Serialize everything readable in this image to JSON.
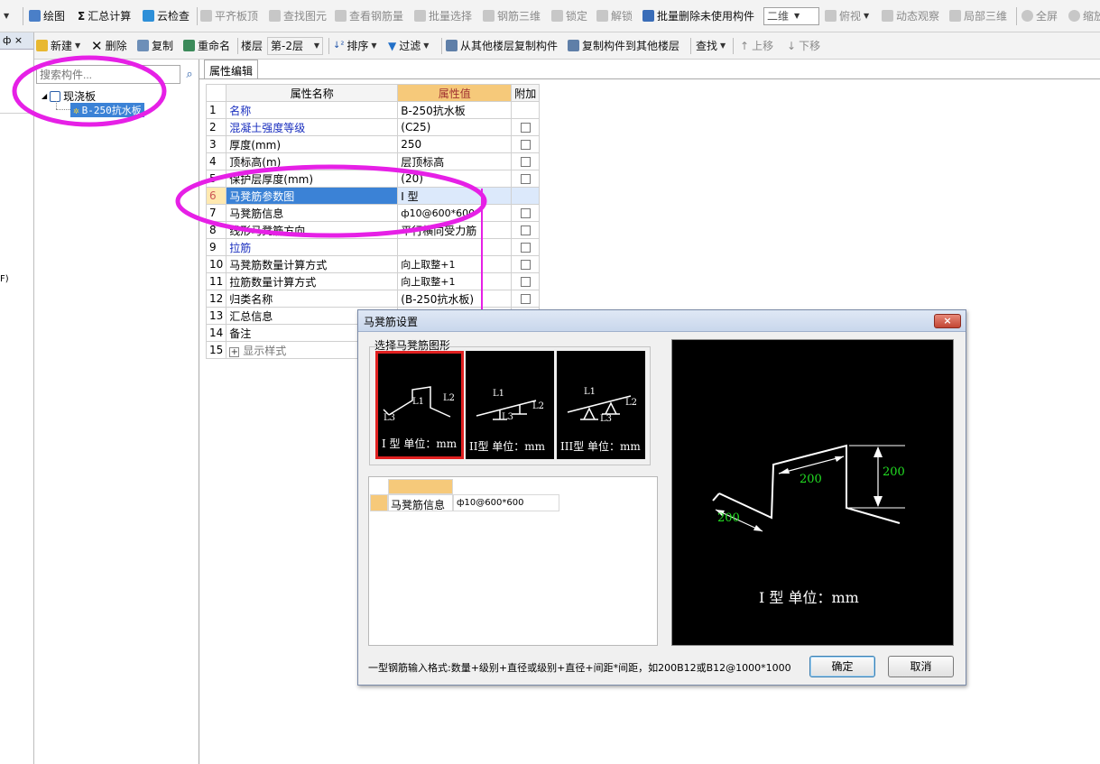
{
  "toolbar1": {
    "draw": "绘图",
    "summary": "汇总计算",
    "cloud_check": "云检查",
    "flush_slab": "平齐板顶",
    "find_element": "查找图元",
    "view_rebar": "查看钢筋量",
    "batch_select": "批量选择",
    "rebar_3d": "钢筋三维",
    "lock": "锁定",
    "unlock": "解锁",
    "batch_delete": "批量删除未使用构件",
    "view_mode": "二维",
    "top_view": "俯视",
    "dynamic_view": "动态观察",
    "local_3d": "局部三维",
    "fullscreen": "全屏",
    "zoom": "缩放"
  },
  "toolbar2": {
    "new": "新建",
    "delete": "删除",
    "copy": "复制",
    "rename": "重命名",
    "floor_label": "楼层",
    "floor_value": "第-2层",
    "sort": "排序",
    "filter": "过滤",
    "copy_from_floor": "从其他楼层复制构件",
    "copy_to_floor": "复制构件到其他楼层",
    "find": "查找",
    "move_up": "上移",
    "move_down": "下移"
  },
  "left_strip": {
    "pin": "ф ×",
    "snippet": "F)"
  },
  "tree": {
    "search_placeholder": "搜索构件...",
    "root": "现浇板",
    "child": "B-250抗水板"
  },
  "property_tab": "属性编辑",
  "grid": {
    "headers": [
      "属性名称",
      "属性值",
      "附加"
    ],
    "rows": [
      {
        "no": "1",
        "name": "名称",
        "value": "B-250抗水板",
        "blue": true,
        "check": false
      },
      {
        "no": "2",
        "name": "混凝土强度等级",
        "value": "(C25)",
        "blue": true,
        "check": true
      },
      {
        "no": "3",
        "name": "厚度(mm)",
        "value": "250",
        "blue": false,
        "check": true
      },
      {
        "no": "4",
        "name": "顶标高(m)",
        "value": "层顶标高",
        "blue": false,
        "check": true
      },
      {
        "no": "5",
        "name": "保护层厚度(mm)",
        "value": "(20)",
        "blue": false,
        "check": true
      },
      {
        "no": "6",
        "name": "马凳筋参数图",
        "value": "I 型",
        "blue": false,
        "check": false
      },
      {
        "no": "7",
        "name": "马凳筋信息",
        "value": "ф10@600*600",
        "blue": false,
        "check": true
      },
      {
        "no": "8",
        "name": "线形马凳筋方向",
        "value": "平行横向受力筋",
        "blue": false,
        "check": true
      },
      {
        "no": "9",
        "name": "拉筋",
        "value": "",
        "blue": true,
        "check": true
      },
      {
        "no": "10",
        "name": "马凳筋数量计算方式",
        "value": "向上取整+1",
        "blue": false,
        "check": true
      },
      {
        "no": "11",
        "name": "拉筋数量计算方式",
        "value": "向上取整+1",
        "blue": false,
        "check": true
      },
      {
        "no": "12",
        "name": "归类名称",
        "value": "(B-250抗水板)",
        "blue": false,
        "check": true
      },
      {
        "no": "13",
        "name": "汇总信息",
        "value": "",
        "blue": false,
        "check": false
      },
      {
        "no": "14",
        "name": "备注",
        "value": "",
        "blue": false,
        "check": false
      },
      {
        "no": "15",
        "name": "显示样式",
        "value": "",
        "blue": false,
        "check": false
      }
    ]
  },
  "dialog": {
    "title": "马凳筋设置",
    "close": "×",
    "group_label": "选择马凳筋图形",
    "shapes": [
      {
        "caption": "I 型  单位：mm",
        "l1": "L1",
        "l2": "L2",
        "l3": "L3"
      },
      {
        "caption": "II型  单位：mm",
        "l1": "L1",
        "l2": "L2",
        "l3": "L3"
      },
      {
        "caption": "III型  单位：mm",
        "l1": "L1",
        "l2": "L2",
        "l3": "L3"
      }
    ],
    "param_name": "马凳筋信息",
    "param_value": "ф10@600*600",
    "preview_dim_1": "200",
    "preview_dim_2": "200",
    "preview_dim_3": "200",
    "preview_caption": "I 型  单位：mm",
    "hint": "一型钢筋输入格式:数量+级别+直径或级别+直径+间距*间距，如200B12或B12@1000*1000",
    "ok": "确定",
    "cancel": "取消"
  },
  "colors": {
    "annotation": "#e620e6",
    "selected_row": "#3b82d6",
    "header_gold": "#f6c97a",
    "dim_green": "#22dd22"
  }
}
